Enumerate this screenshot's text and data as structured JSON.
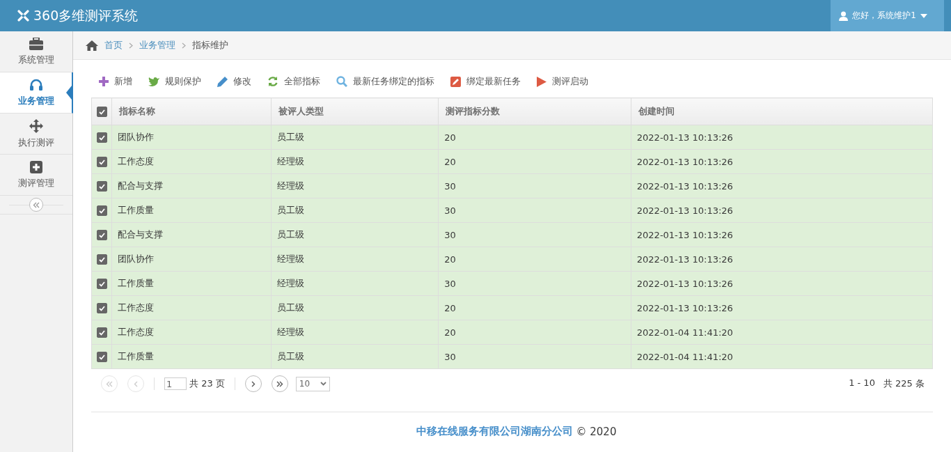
{
  "header": {
    "title": "360多维测评系统",
    "user": "您好，系统维护1"
  },
  "sidebar": {
    "items": [
      {
        "kind": "briefcase",
        "label": "系统管理",
        "selected": false
      },
      {
        "kind": "headset",
        "label": "业务管理",
        "selected": true
      },
      {
        "kind": "move",
        "label": "执行测评",
        "selected": false
      },
      {
        "kind": "plus",
        "label": "测评管理",
        "selected": false
      }
    ]
  },
  "breadcrumb": [
    "首页",
    "业务管理",
    "指标维护"
  ],
  "toolbar": [
    {
      "kind": "plus",
      "label": "新增"
    },
    {
      "kind": "bird",
      "label": "规则保护"
    },
    {
      "kind": "pencil",
      "label": "修改"
    },
    {
      "kind": "refresh",
      "label": "全部指标"
    },
    {
      "kind": "search",
      "label": "最新任务绑定的指标"
    },
    {
      "kind": "edit",
      "label": "绑定最新任务"
    },
    {
      "kind": "play",
      "label": "测评启动"
    }
  ],
  "table": {
    "all_checked": true,
    "columns": [
      "指标名称",
      "被评人类型",
      "测评指标分数",
      "创建时间"
    ],
    "rows": [
      {
        "checked": true,
        "cells": [
          "团队协作",
          "员工级",
          "20",
          "2022-01-13 10:13:26"
        ]
      },
      {
        "checked": true,
        "cells": [
          "工作态度",
          "经理级",
          "20",
          "2022-01-13 10:13:26"
        ]
      },
      {
        "checked": true,
        "cells": [
          "配合与支撑",
          "经理级",
          "30",
          "2022-01-13 10:13:26"
        ]
      },
      {
        "checked": true,
        "cells": [
          "工作质量",
          "员工级",
          "30",
          "2022-01-13 10:13:26"
        ]
      },
      {
        "checked": true,
        "cells": [
          "配合与支撑",
          "员工级",
          "30",
          "2022-01-13 10:13:26"
        ]
      },
      {
        "checked": true,
        "cells": [
          "团队协作",
          "经理级",
          "20",
          "2022-01-13 10:13:26"
        ]
      },
      {
        "checked": true,
        "cells": [
          "工作质量",
          "经理级",
          "30",
          "2022-01-13 10:13:26"
        ]
      },
      {
        "checked": true,
        "cells": [
          "工作态度",
          "员工级",
          "20",
          "2022-01-13 10:13:26"
        ]
      },
      {
        "checked": true,
        "cells": [
          "工作态度",
          "经理级",
          "20",
          "2022-01-04 11:41:20"
        ]
      },
      {
        "checked": true,
        "cells": [
          "工作质量",
          "员工级",
          "30",
          "2022-01-04 11:41:20"
        ]
      }
    ]
  },
  "pager": {
    "first_disabled": true,
    "prev_disabled": true,
    "page": "1",
    "total_pages": "共 23 页",
    "page_size": "10",
    "range": "1 - 10",
    "total": "共 225 条"
  },
  "footer": {
    "company": "中移在线服务有限公司湖南分公司",
    "copyright": "© 2020"
  }
}
